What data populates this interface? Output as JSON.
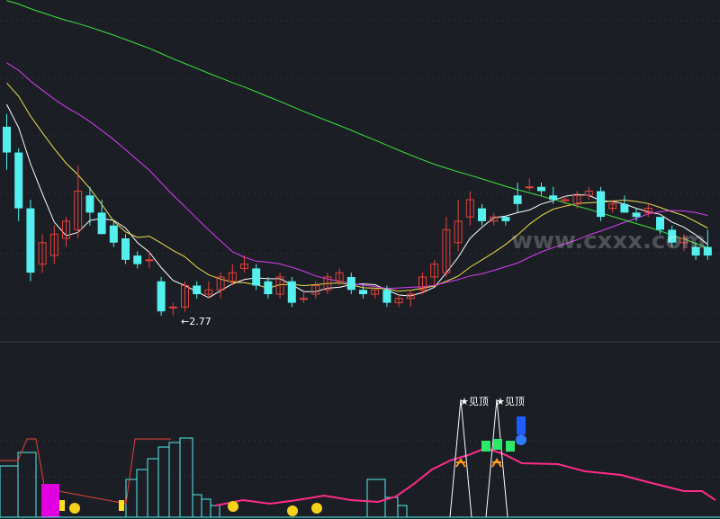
{
  "watermark": "www.cxxx.com",
  "chart_data": [
    {
      "type": "candlestick",
      "panel": "main",
      "annotations": {
        "low_label": "←2.77",
        "low_value": 2.77
      },
      "colors": {
        "up": "#e8413a",
        "down": "#54f0f0",
        "grid": "#2c313b",
        "ma5": "#ffffff",
        "ma10": "#f0e04a",
        "ma20": "#e03cff",
        "ma60": "#3ce63c"
      },
      "candles": [
        [
          3.22,
          3.25,
          3.12,
          3.16
        ],
        [
          3.16,
          3.17,
          3.0,
          3.03
        ],
        [
          3.03,
          3.05,
          2.86,
          2.88
        ],
        [
          2.9,
          2.97,
          2.88,
          2.95
        ],
        [
          2.92,
          2.99,
          2.9,
          2.97
        ],
        [
          2.96,
          3.01,
          2.94,
          3.0
        ],
        [
          2.98,
          3.13,
          2.96,
          3.07
        ],
        [
          3.06,
          3.08,
          2.99,
          3.02
        ],
        [
          3.02,
          3.05,
          2.97,
          2.97
        ],
        [
          2.99,
          3.0,
          2.94,
          2.95
        ],
        [
          2.96,
          2.97,
          2.9,
          2.91
        ],
        [
          2.92,
          2.93,
          2.89,
          2.9
        ],
        [
          2.91,
          2.93,
          2.89,
          2.91
        ],
        [
          2.86,
          2.87,
          2.78,
          2.79
        ],
        [
          2.8,
          2.81,
          2.78,
          2.8
        ],
        [
          2.8,
          2.86,
          2.79,
          2.85
        ],
        [
          2.85,
          2.86,
          2.82,
          2.83
        ],
        [
          2.83,
          2.86,
          2.82,
          2.84
        ],
        [
          2.84,
          2.88,
          2.82,
          2.87
        ],
        [
          2.86,
          2.9,
          2.85,
          2.88
        ],
        [
          2.89,
          2.92,
          2.88,
          2.9
        ],
        [
          2.89,
          2.9,
          2.84,
          2.85
        ],
        [
          2.86,
          2.87,
          2.82,
          2.83
        ],
        [
          2.83,
          2.88,
          2.82,
          2.87
        ],
        [
          2.86,
          2.87,
          2.8,
          2.81
        ],
        [
          2.82,
          2.84,
          2.81,
          2.82
        ],
        [
          2.83,
          2.86,
          2.82,
          2.85
        ],
        [
          2.84,
          2.88,
          2.83,
          2.87
        ],
        [
          2.86,
          2.89,
          2.85,
          2.88
        ],
        [
          2.87,
          2.88,
          2.83,
          2.84
        ],
        [
          2.84,
          2.85,
          2.82,
          2.83
        ],
        [
          2.83,
          2.84,
          2.82,
          2.84
        ],
        [
          2.84,
          2.85,
          2.8,
          2.81
        ],
        [
          2.81,
          2.83,
          2.8,
          2.82
        ],
        [
          2.82,
          2.84,
          2.8,
          2.83
        ],
        [
          2.84,
          2.88,
          2.83,
          2.87
        ],
        [
          2.87,
          2.91,
          2.85,
          2.9
        ],
        [
          2.88,
          3.01,
          2.87,
          2.98
        ],
        [
          2.95,
          3.05,
          2.93,
          3.0
        ],
        [
          3.01,
          3.07,
          2.99,
          3.05
        ],
        [
          3.03,
          3.04,
          2.99,
          3.0
        ],
        [
          3.0,
          3.02,
          2.99,
          3.01
        ],
        [
          3.01,
          3.01,
          2.99,
          3.0
        ],
        [
          3.06,
          3.09,
          3.02,
          3.04
        ],
        [
          3.08,
          3.1,
          3.07,
          3.08
        ],
        [
          3.08,
          3.09,
          3.06,
          3.07
        ],
        [
          3.06,
          3.08,
          3.04,
          3.05
        ],
        [
          3.05,
          3.06,
          3.04,
          3.05
        ],
        [
          3.04,
          3.07,
          3.03,
          3.06
        ],
        [
          3.06,
          3.08,
          3.05,
          3.07
        ],
        [
          3.07,
          3.08,
          3.0,
          3.01
        ],
        [
          3.03,
          3.05,
          3.02,
          3.04
        ],
        [
          3.04,
          3.06,
          3.02,
          3.02
        ],
        [
          3.02,
          3.03,
          3.0,
          3.01
        ],
        [
          3.02,
          3.04,
          3.01,
          3.03
        ],
        [
          3.01,
          3.01,
          2.97,
          2.98
        ],
        [
          2.98,
          2.99,
          2.94,
          2.95
        ],
        [
          2.95,
          2.97,
          2.93,
          2.96
        ],
        [
          2.94,
          2.95,
          2.91,
          2.92
        ],
        [
          2.94,
          2.98,
          2.91,
          2.92
        ]
      ]
    },
    {
      "type": "histogram",
      "panel": "indicator",
      "annotations": [
        {
          "text": "★见顶"
        },
        {
          "text": "★见顶"
        }
      ]
    }
  ]
}
